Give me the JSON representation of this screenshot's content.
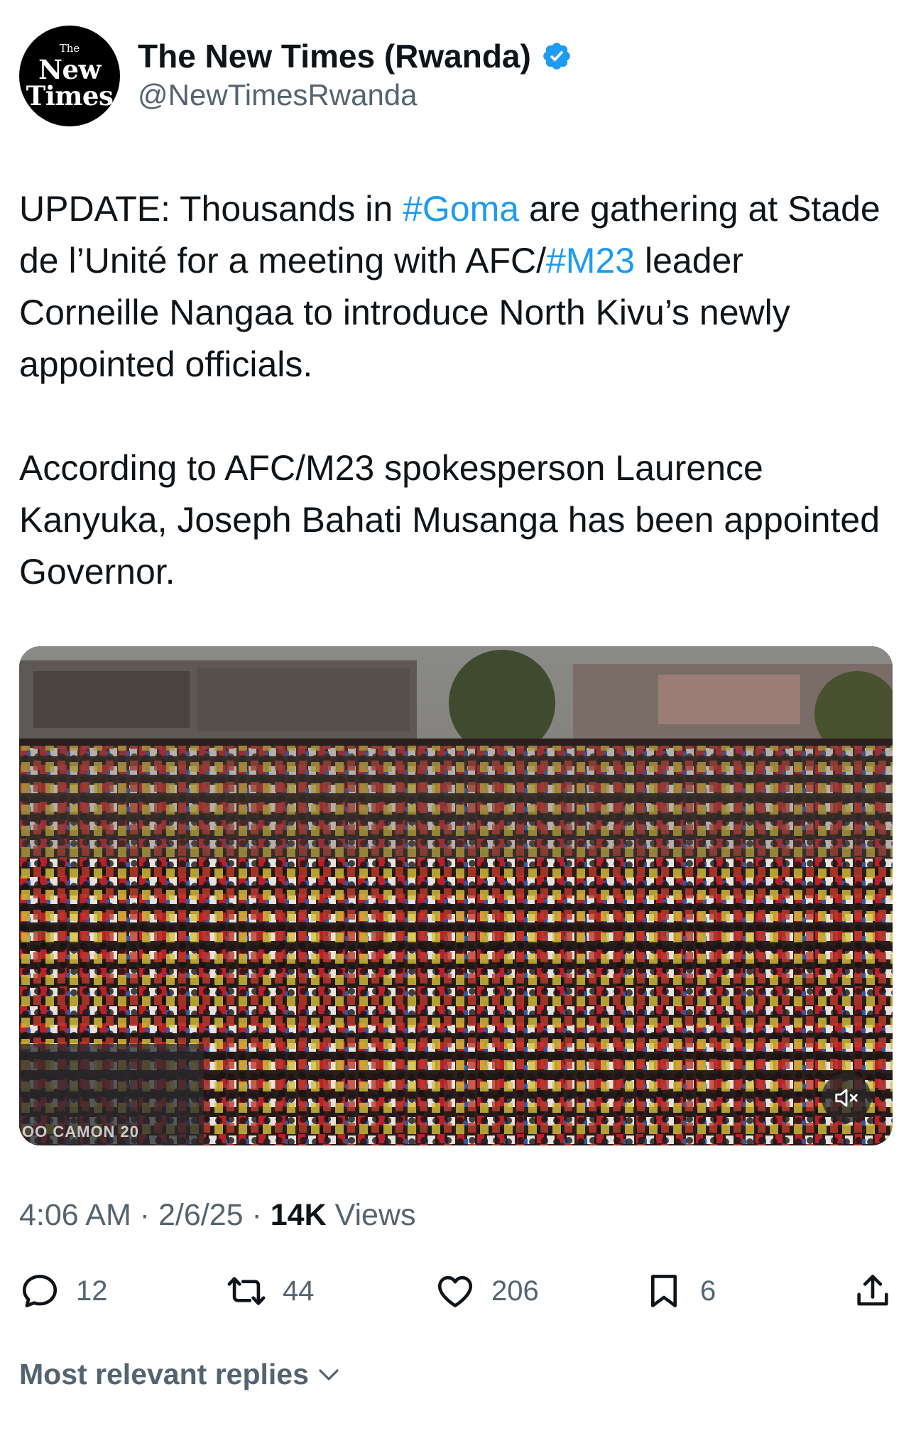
{
  "account": {
    "avatar_line1": "The",
    "avatar_line2": "New",
    "avatar_line3": "Times",
    "display_name": "The New Times (Rwanda)",
    "handle": "@NewTimesRwanda",
    "verified": true
  },
  "tweet": {
    "p1": {
      "t1": "UPDATE: Thousands in ",
      "tag1": "#Goma",
      "t2": " are gathering at Stade de l’Unité for a meeting with AFC/",
      "tag2": "#M23",
      "t3": " leader Corneille Nangaa to introduce North Kivu’s newly appointed officials."
    },
    "p2": "According to AFC/M23 spokesperson Laurence Kanyuka, Joseph Bahati Musanga has been appointed Governor."
  },
  "media": {
    "type": "video",
    "description_icon": "mute-icon",
    "watermark": "OO CAMON 20"
  },
  "meta": {
    "time": "4:06 AM",
    "sep1": " · ",
    "date": "2/6/25",
    "sep2": " · ",
    "views_count": "14K",
    "views_label": " Views"
  },
  "actions": {
    "replies": "12",
    "reposts": "44",
    "likes": "206",
    "bookmarks": "6"
  },
  "replies_sort": {
    "label": "Most relevant replies"
  },
  "colors": {
    "link": "#1d9bf0",
    "secondary_text": "#536471",
    "primary_text": "#0f1419",
    "verified": "#1d9bf0"
  }
}
